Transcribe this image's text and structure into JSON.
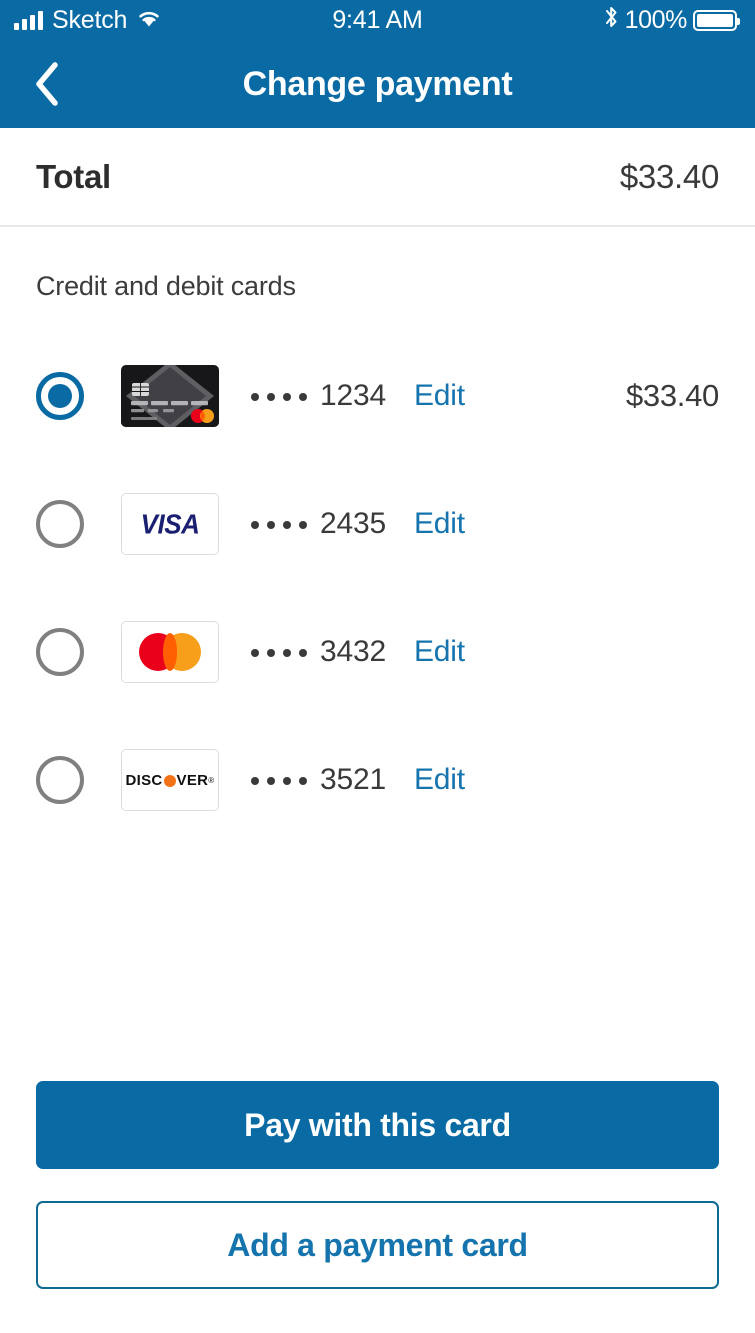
{
  "status_bar": {
    "carrier": "Sketch",
    "time": "9:41 AM",
    "battery_percent": "100%",
    "signal_icon": "signal-bars-icon",
    "wifi_icon": "wifi-icon",
    "bluetooth_icon": "bluetooth-icon",
    "battery_icon": "battery-full-icon"
  },
  "navbar": {
    "title": "Change payment",
    "back_icon": "chevron-left-icon"
  },
  "total": {
    "label": "Total",
    "amount": "$33.40"
  },
  "section": {
    "title": "Credit and debit cards"
  },
  "cards": [
    {
      "brand": "black-card",
      "brand_label": "",
      "masked_dots": "• • • •",
      "last4": "1234",
      "edit_label": "Edit",
      "amount": "$33.40",
      "selected": true
    },
    {
      "brand": "visa",
      "brand_label": "VISA",
      "masked_dots": "• • • •",
      "last4": "2435",
      "edit_label": "Edit",
      "amount": "",
      "selected": false
    },
    {
      "brand": "mastercard",
      "brand_label": "",
      "masked_dots": "• • • •",
      "last4": "3432",
      "edit_label": "Edit",
      "amount": "",
      "selected": false
    },
    {
      "brand": "discover",
      "brand_label": "DISCVER",
      "masked_dots": "• • • •",
      "last4": "3521",
      "edit_label": "Edit",
      "amount": "",
      "selected": false
    }
  ],
  "footer": {
    "pay_label": "Pay with this card",
    "add_label": "Add a payment card"
  },
  "colors": {
    "brand_blue": "#0a6ba4",
    "link_blue": "#1574ad",
    "text_dark": "#3a3a3a",
    "divider": "#e8e8e8",
    "visa_navy": "#1a1f71",
    "mc_red": "#eb001b",
    "mc_yellow": "#f79e1b",
    "discover_orange": "#f47216"
  }
}
